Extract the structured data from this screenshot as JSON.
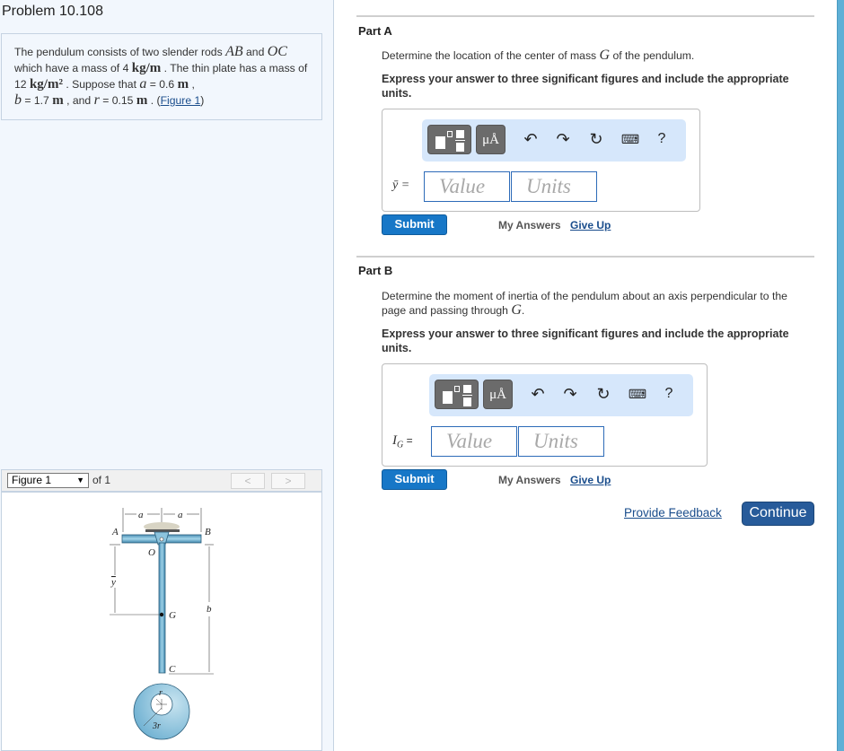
{
  "problem": {
    "title": "Problem 10.108",
    "text_1": "The pendulum consists of two slender rods ",
    "rod_ab": "AB",
    "text_and": " and ",
    "rod_oc": "OC",
    "text_2": " which have a mass of 4 ",
    "unit_kgm": "kg/m",
    "text_3": " . The thin plate has a mass of 12 ",
    "unit_kgm2": "kg/m²",
    "text_4": " . Suppose that ",
    "var_a": "a",
    "val_a": " = 0.6 ",
    "unit_m": "m",
    "comma": " ,",
    "var_b": "b",
    "val_b": " = 1.7 ",
    "text_and2": " , and ",
    "var_r": "r",
    "val_r": " = 0.15 ",
    "text_end": " . (",
    "figure_link": "Figure 1",
    "close_paren": ")"
  },
  "figure": {
    "select_value": "Figure 1",
    "of_label": "of 1",
    "prev_label": "<",
    "next_label": ">",
    "labels": {
      "a1": "a",
      "a2": "a",
      "A": "A",
      "B": "B",
      "O": "O",
      "ybar": "y",
      "G": "G",
      "b": "b",
      "C": "C",
      "r": "r",
      "three_r": "3r"
    }
  },
  "parts": [
    {
      "title": "Part A",
      "prompt_pre": "Determine the location of the center of mass ",
      "prompt_var": "G",
      "prompt_post": " of the pendulum.",
      "instruction": "Express your answer to three significant figures and include the appropriate units.",
      "answer_label": "ȳ =",
      "value_placeholder": "Value",
      "units_placeholder": "Units",
      "submit_label": "Submit",
      "my_answers_label": "My Answers",
      "give_up_label": "Give Up"
    },
    {
      "title": "Part B",
      "prompt_pre": "Determine the moment of inertia of the pendulum about an axis perpendicular to the page and passing through ",
      "prompt_var": "G",
      "prompt_post": ".",
      "instruction": "Express your answer to three significant figures and include the appropriate units.",
      "answer_label_main": "I",
      "answer_label_sub": "G",
      "answer_label_eq": " =",
      "value_placeholder": "Value",
      "units_placeholder": "Units",
      "submit_label": "Submit",
      "my_answers_label": "My Answers",
      "give_up_label": "Give Up"
    }
  ],
  "toolbar": {
    "icons": [
      "templates-icon",
      "units-icon",
      "undo-icon",
      "redo-icon",
      "reset-icon",
      "keyboard-icon",
      "help-icon"
    ],
    "units_label": "μÅ",
    "help_label": "?"
  },
  "footer": {
    "feedback_label": "Provide Feedback",
    "continue_label": "Continue"
  },
  "colors": {
    "accent_submit": "#1777c7",
    "continue_button": "#275b9a",
    "toolbar_bg": "#d6e7fb",
    "link": "#1a4d8c"
  }
}
